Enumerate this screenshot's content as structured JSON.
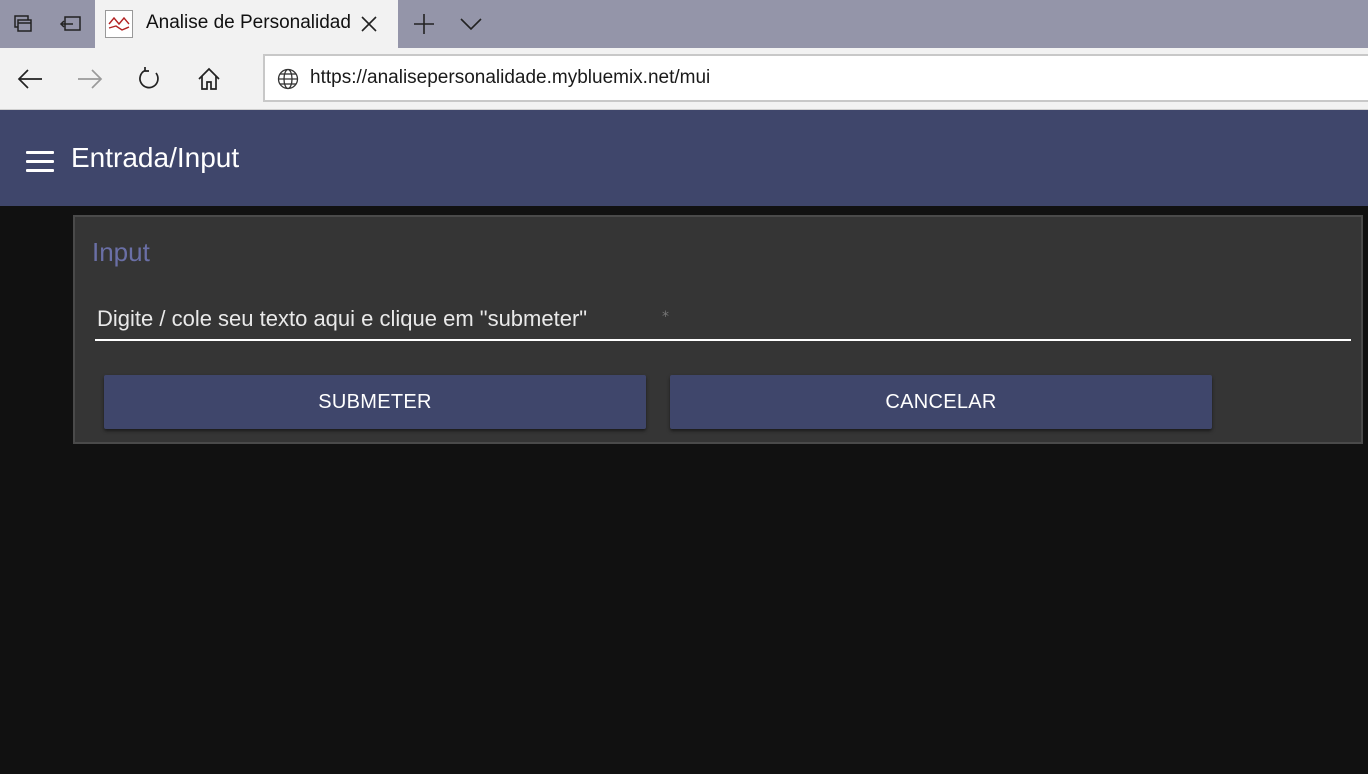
{
  "browser": {
    "tab": {
      "title": "Analise de Personalidad"
    },
    "address": {
      "url": "https://analisepersonalidade.mybluemix.net/mui"
    }
  },
  "appbar": {
    "title": "Entrada/Input"
  },
  "form": {
    "legend": "Input",
    "text_placeholder": "Digite / cole seu texto aqui e clique em \"submeter\"",
    "required_marker": "*",
    "submit_label": "SUBMETER",
    "cancel_label": "CANCELAR"
  },
  "colors": {
    "appbar": "#3f466b",
    "accent": "#6a6fa6",
    "background": "#111111",
    "card": "#353535"
  }
}
